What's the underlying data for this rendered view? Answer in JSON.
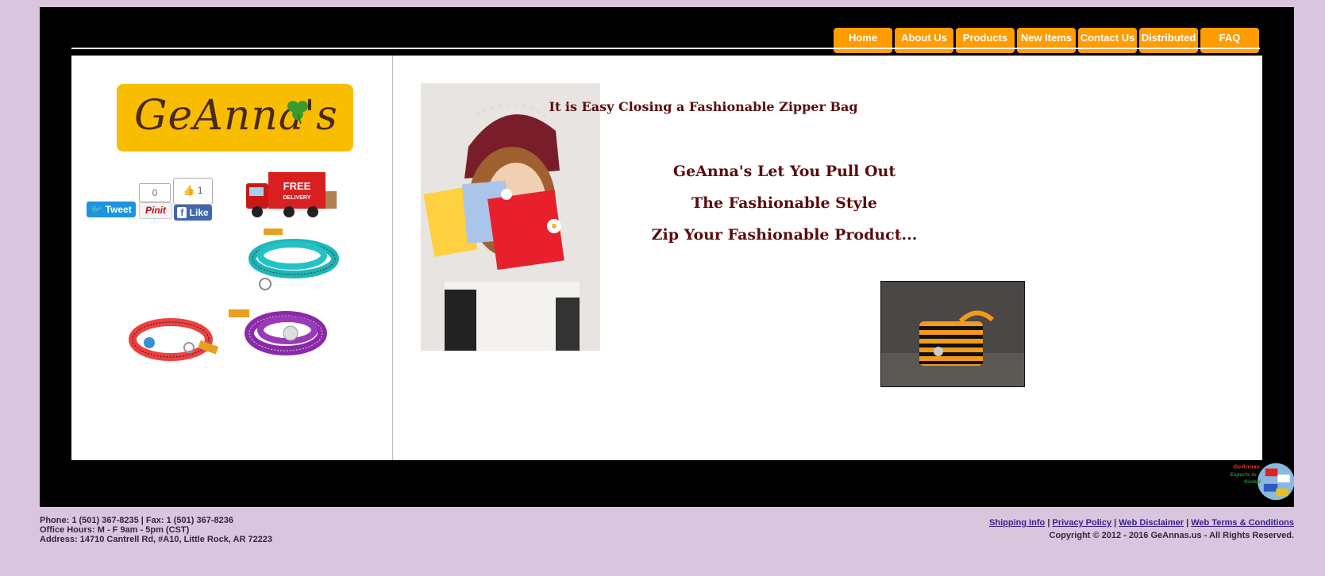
{
  "nav": {
    "items": [
      "Home",
      "About Us",
      "Products",
      "New Items",
      "Contact Us",
      "Distributed",
      "FAQ"
    ]
  },
  "logo": {
    "text": "GeAnna's"
  },
  "social": {
    "tweet_label": "Tweet",
    "pin_count": "0",
    "pin_label": "Pinit",
    "like_count": "1",
    "like_label": "Like"
  },
  "delivery": {
    "line1": "FREE",
    "line2": "DELIVERY"
  },
  "hero": {
    "headline": "It is Easy Closing a Fashionable Zipper Bag",
    "line1": "GeAnna's Let You Pull Out",
    "line2": "The Fashionable Style",
    "line3": "Zip Your Fashionable Product..."
  },
  "badge": {
    "line1": "GeAnnas",
    "line2": "Exports to",
    "line3": "Global"
  },
  "footer": {
    "phone": "Phone: 1 (501) 367-8235 | Fax: 1 (501) 367-8236",
    "hours": "Office Hours: M - F 9am - 5pm (CST)",
    "address": "Address: 14710 Cantrell Rd, #A10, Little Rock, AR 72223",
    "links": [
      "Shipping Info",
      "Privacy Policy",
      "Web Disclaimer",
      "Web Terms & Conditions"
    ],
    "copyright": "Copyright © 2012 - 2016 GeAnnas.us - All Rights Reserved."
  },
  "colors": {
    "background": "#d9c6de",
    "nav_button": "#ff9c00",
    "hero_text": "#5a0c0c",
    "logo_bg": "#f9bd00"
  }
}
